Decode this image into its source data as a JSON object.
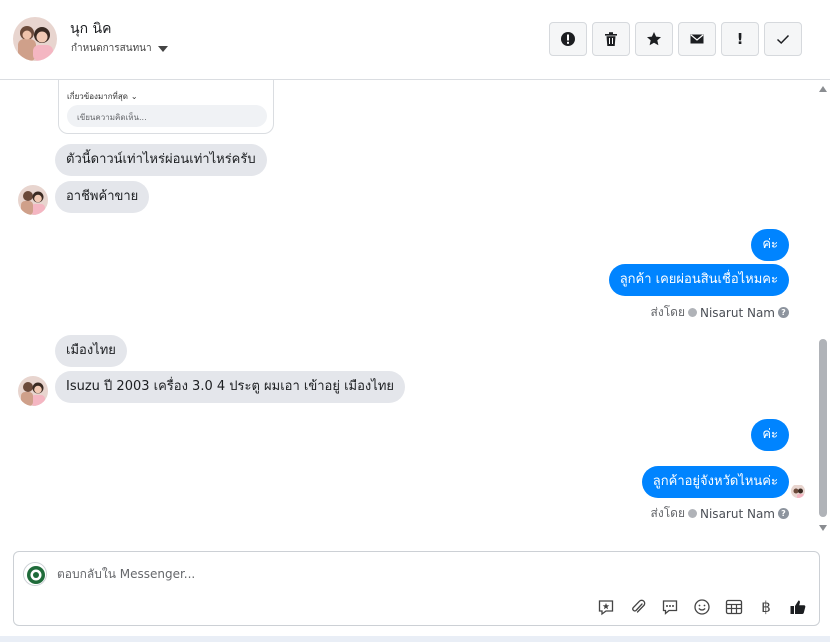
{
  "header": {
    "contact_name": "นุก นิค",
    "assign_label": "กำหนดการสนทนา",
    "actions": [
      {
        "name": "report-spam-button",
        "icon": "alert-circle-icon"
      },
      {
        "name": "delete-button",
        "icon": "trash-icon"
      },
      {
        "name": "star-button",
        "icon": "star-icon"
      },
      {
        "name": "mark-unread-button",
        "icon": "envelope-icon"
      },
      {
        "name": "follow-up-button",
        "icon": "exclamation-icon",
        "text": "!"
      },
      {
        "name": "mark-done-button",
        "icon": "check-icon"
      }
    ]
  },
  "post_preview": {
    "sort_label": "เกี่ยวข้องมากที่สุด",
    "comment_placeholder": "เขียนความคิดเห็น..."
  },
  "messages": [
    {
      "id": "m1",
      "direction": "incoming",
      "text": "ตัวนี้ดาวน์เท่าไหร่ผ่อนเท่าไหร่ครับ"
    },
    {
      "id": "m2",
      "direction": "incoming",
      "text": "อาชีพค้าขาย"
    },
    {
      "id": "m3",
      "direction": "outgoing",
      "text": "ค่ะ"
    },
    {
      "id": "m4",
      "direction": "outgoing",
      "text": "ลูกค้า เคยผ่อนสินเชื่อไหมคะ"
    },
    {
      "id": "m5",
      "direction": "incoming",
      "text": "เมืองไทย"
    },
    {
      "id": "m6",
      "direction": "incoming",
      "text": "Isuzu ปี 2003 เครื่อง 3.0 4 ประตู ผมเอา เข้าอยู่ เมืองไทย"
    },
    {
      "id": "m7",
      "direction": "outgoing",
      "text": "ค่ะ"
    },
    {
      "id": "m8",
      "direction": "outgoing",
      "text": "ลูกค้าอยู่จังหวัดไหนค่ะ"
    }
  ],
  "sent_by": {
    "prefix": "ส่งโดย",
    "agent_name": "Nisarut Nam",
    "help": "?"
  },
  "composer": {
    "placeholder": "ตอบกลับใน Messenger...",
    "tools": [
      "saved-reply-icon",
      "attachment-icon",
      "chat-bubble-icon",
      "emoji-icon",
      "table-icon",
      "baht-icon",
      "like-icon"
    ],
    "baht_symbol": "฿"
  },
  "colors": {
    "outgoing_bubble": "#0084ff",
    "incoming_bubble": "#e4e6eb",
    "border": "#dadde1"
  }
}
